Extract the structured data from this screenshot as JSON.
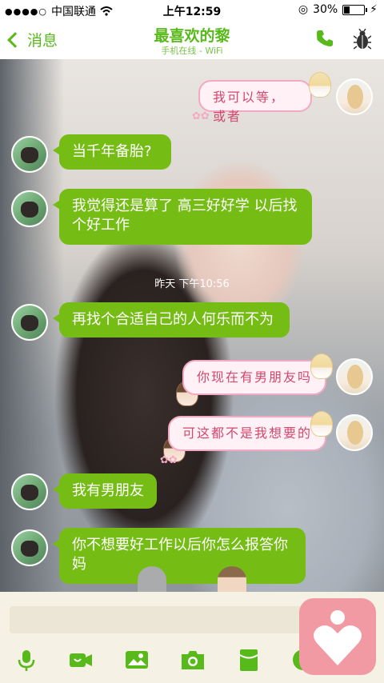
{
  "status_bar": {
    "carrier": "中国联通",
    "time": "上午12:59",
    "battery": "30%",
    "battery_level": 0.3
  },
  "nav": {
    "back_label": "消息",
    "title": "最喜欢的黎",
    "subtitle": "手机在线 - WiFi"
  },
  "messages": [
    {
      "side": "out",
      "text": "我可以等，或者"
    },
    {
      "side": "in",
      "text": "当千年备胎?"
    },
    {
      "side": "in",
      "text": "我觉得还是算了 高三好好学 以后找个好工作"
    },
    {
      "side": "in",
      "text": "再找个合适自己的人何乐而不为"
    },
    {
      "side": "out",
      "text": "你现在有男朋友吗"
    },
    {
      "side": "out",
      "text": "可这都不是我想要的"
    },
    {
      "side": "in",
      "text": "我有男朋友"
    },
    {
      "side": "in",
      "text": "你不想要好工作以后你怎么报答你妈"
    }
  ],
  "timestamp": "昨天 下午10:56",
  "toolbar": {
    "icons": [
      "microphone-icon",
      "video-icon",
      "image-icon",
      "camera-icon",
      "red-packet-icon",
      "emoji-icon"
    ]
  },
  "colors": {
    "accent": "#58b91a",
    "bubble_in": "#75bd15",
    "bubble_out_text": "#d2486e"
  }
}
